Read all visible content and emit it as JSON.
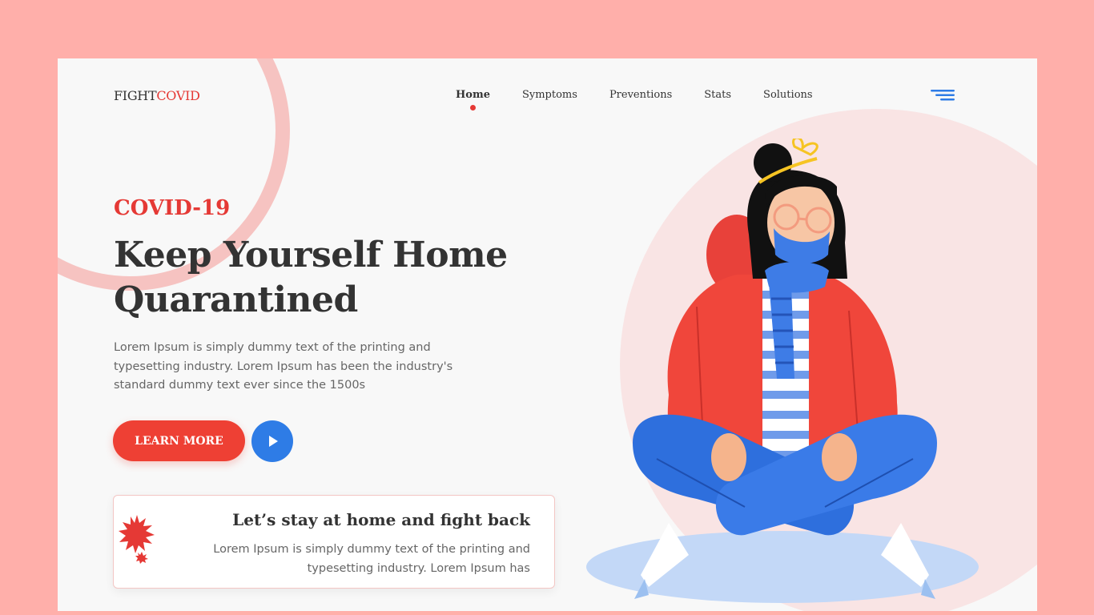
{
  "brand": {
    "part1": "FIGHT",
    "part2": "COVID"
  },
  "nav": {
    "items": [
      {
        "label": "Home",
        "active": true
      },
      {
        "label": "Symptoms",
        "active": false
      },
      {
        "label": "Preventions",
        "active": false
      },
      {
        "label": "Stats",
        "active": false
      },
      {
        "label": "Solutions",
        "active": false
      }
    ],
    "menu_icon": "hamburger-menu-icon"
  },
  "hero": {
    "eyebrow": "COVID-19",
    "headline": "Keep Yourself Home Quarantined",
    "description": "Lorem Ipsum is simply dummy text of the printing and typesetting industry. Lorem Ipsum has been the industry's standard dummy text ever since the 1500s",
    "cta_label": "LEARN MORE",
    "play_icon": "play-icon"
  },
  "card": {
    "title": "Let’s stay at home and fight back",
    "text": "Lorem Ipsum is simply dummy text of the printing and typesetting industry. Lorem Ipsum has",
    "icon": "virus-icon"
  },
  "colors": {
    "page_bg": "#FFAFAA",
    "frame_bg": "#F8F8F8",
    "accent_red": "#E53935",
    "accent_blue": "#2E7CE6",
    "text_dark": "#333333",
    "text_muted": "#666666"
  }
}
